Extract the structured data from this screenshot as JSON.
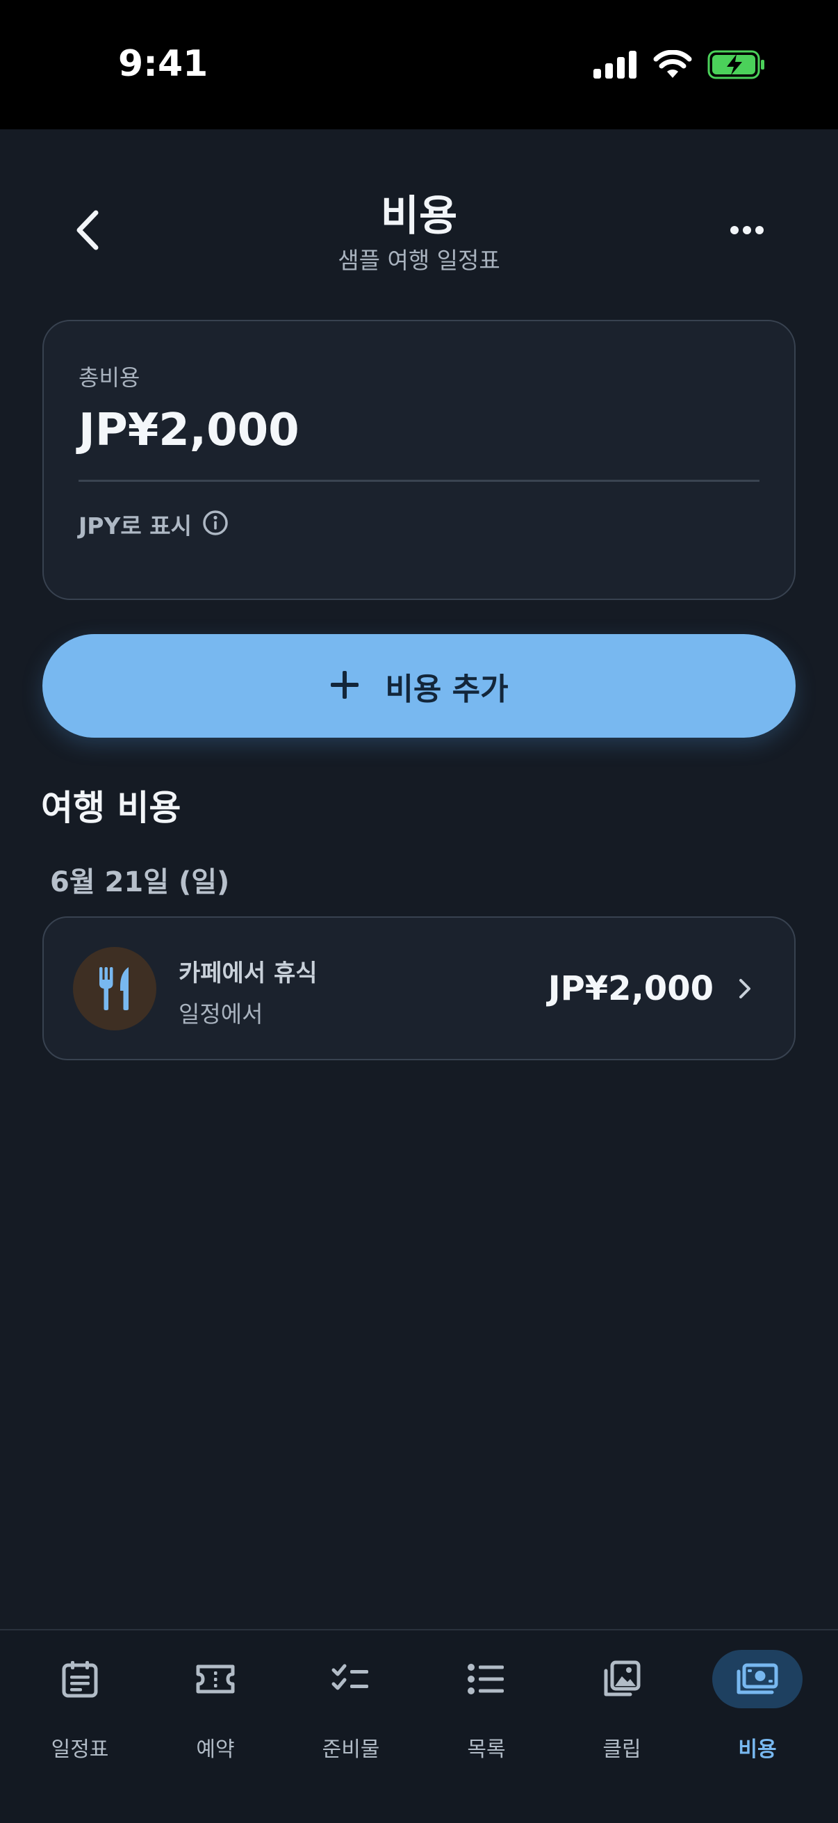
{
  "status": {
    "time": "9:41"
  },
  "header": {
    "title": "비용",
    "subtitle": "샘플 여행 일정표"
  },
  "summary": {
    "label": "총비용",
    "amount": "JP¥2,000",
    "currency_note": "JPY로 표시"
  },
  "add_button": {
    "label": "비용 추가"
  },
  "section": {
    "title": "여행 비용"
  },
  "groups": [
    {
      "date": "6월 21일 (일)",
      "items": [
        {
          "name": "카페에서 휴식",
          "source": "일정에서",
          "amount": "JP¥2,000",
          "icon": "fork-knife-icon"
        }
      ]
    }
  ],
  "tabs": [
    {
      "label": "일정표",
      "icon": "itinerary-icon",
      "active": false
    },
    {
      "label": "예약",
      "icon": "ticket-icon",
      "active": false
    },
    {
      "label": "준비물",
      "icon": "checklist-icon",
      "active": false
    },
    {
      "label": "목록",
      "icon": "list-icon",
      "active": false
    },
    {
      "label": "클립",
      "icon": "photos-icon",
      "active": false
    },
    {
      "label": "비용",
      "icon": "money-icon",
      "active": true
    }
  ],
  "colors": {
    "background": "#151b24",
    "accent": "#78b8f0",
    "card": "#1b222d",
    "food_icon_bg": "#3e2f23"
  }
}
